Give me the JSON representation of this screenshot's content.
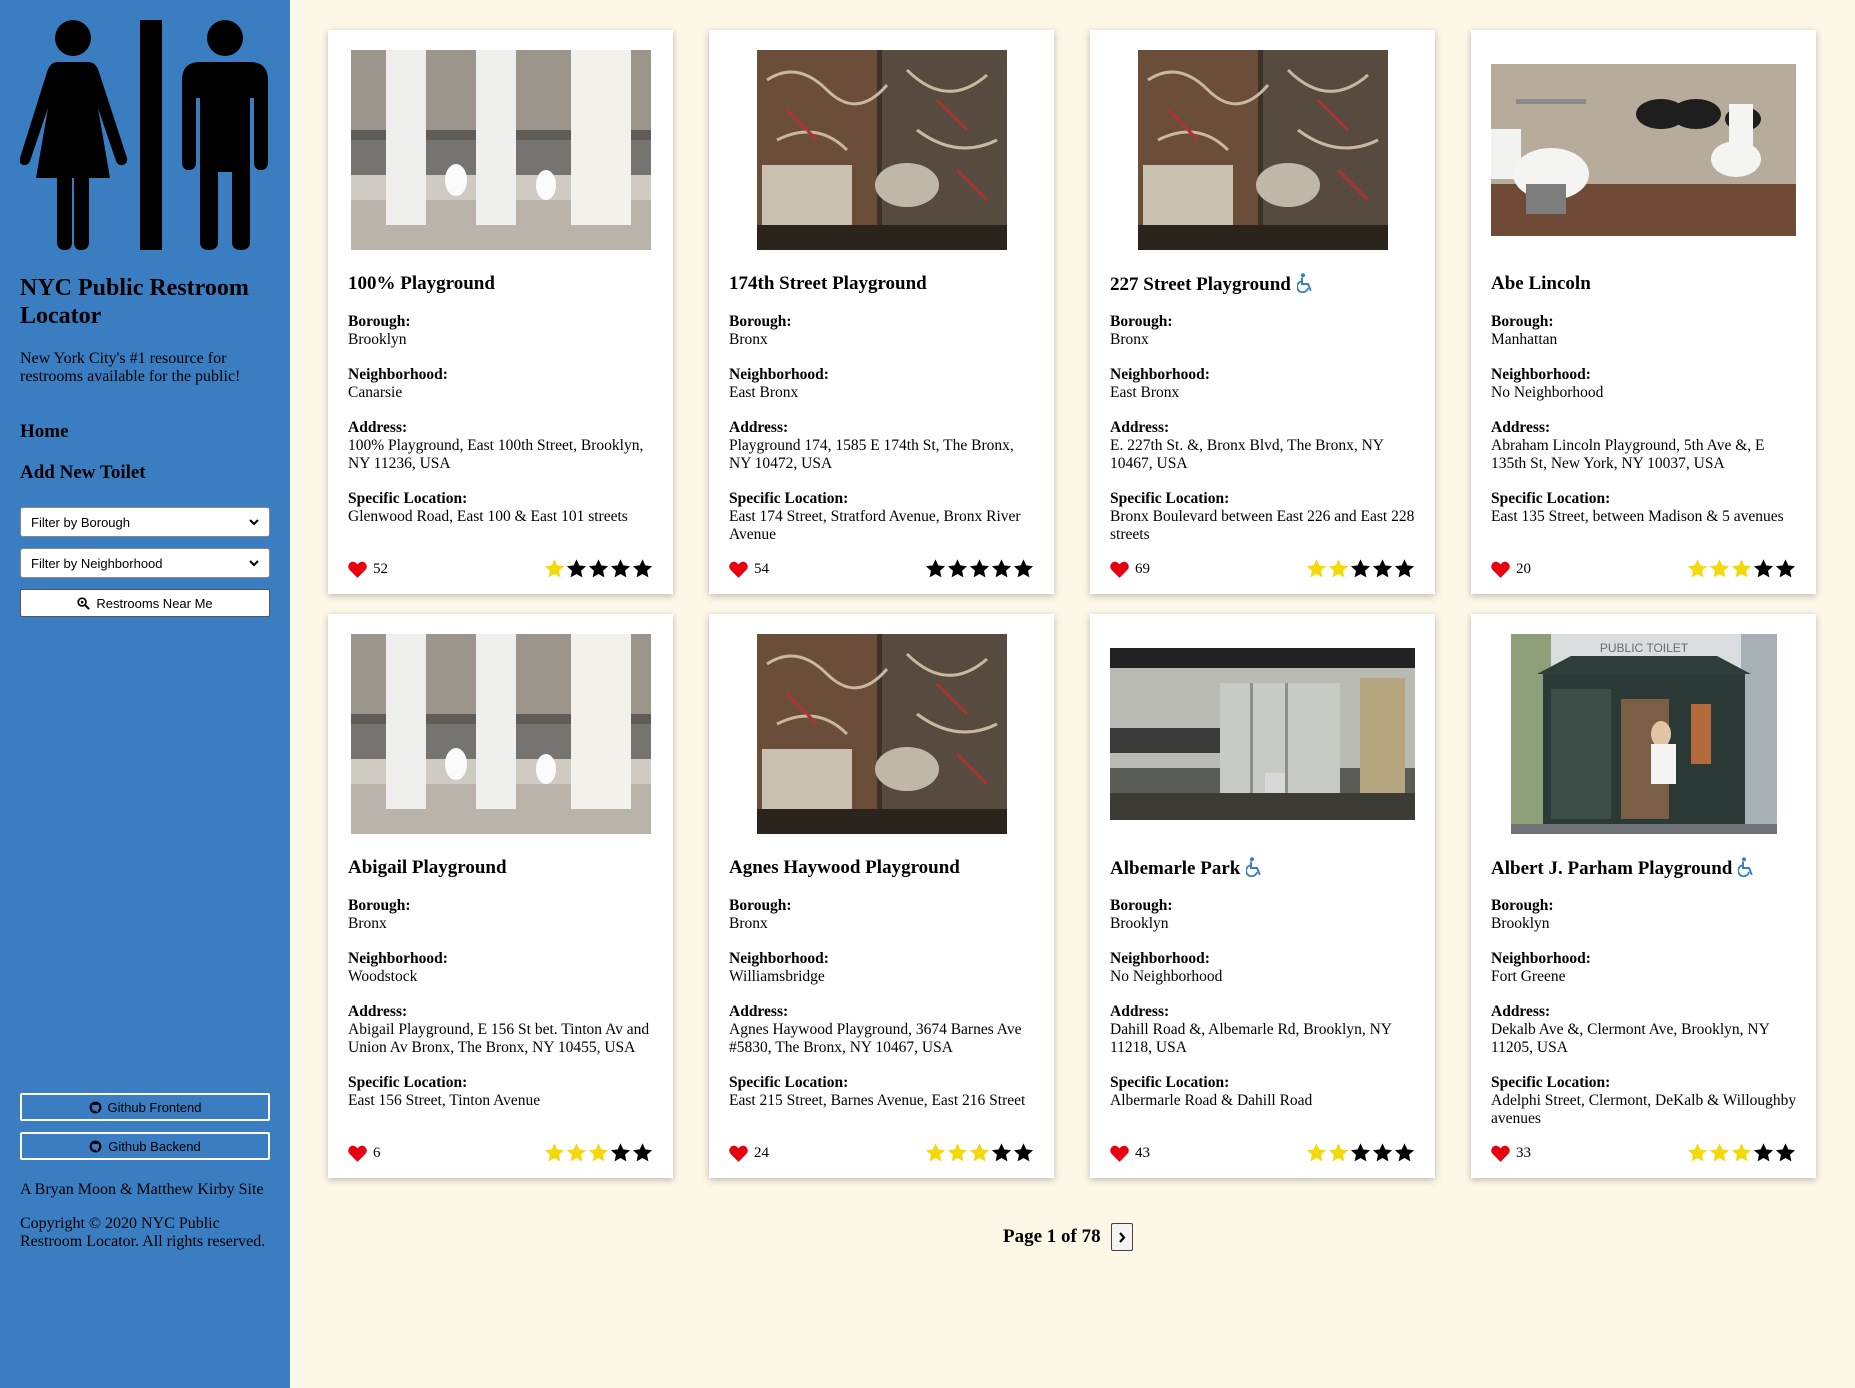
{
  "sidebar": {
    "title": "NYC Public Restroom Locator",
    "tagline": "New York City's #1 resource for restrooms available for the public!",
    "nav": [
      {
        "label": "Home"
      },
      {
        "label": "Add New Toilet"
      }
    ],
    "filter_borough": "Filter by Borough",
    "filter_neighborhood": "Filter by Neighborhood",
    "near_me": "Restrooms Near Me",
    "github_frontend": "Github Frontend",
    "github_backend": "Github Backend",
    "credits": "A Bryan Moon & Matthew Kirby Site",
    "copyright": "Copyright © 2020 NYC Public Restroom Locator. All rights reserved."
  },
  "labels": {
    "borough": "Borough:",
    "neighborhood": "Neighborhood:",
    "address": "Address:",
    "specific": "Specific Location:"
  },
  "colors": {
    "sidebar": "#3a7dc1",
    "background": "#fdf7e8",
    "heart": "#e8000e",
    "star_on": "#f4d90a",
    "accessible": "#3a7dc1"
  },
  "cards": [
    {
      "name": "100% Playground",
      "accessible": false,
      "borough": "Brooklyn",
      "neighborhood": "Canarsie",
      "address": "100% Playground, East 100th Street, Brooklyn, NY 11236, USA",
      "specific": "Glenwood Road, East 100 & East 101 streets",
      "likes": "52",
      "rating": 1,
      "photo": "stalls-icon"
    },
    {
      "name": "174th Street Playground",
      "accessible": false,
      "borough": "Bronx",
      "neighborhood": "East Bronx",
      "address": "Playground 174, 1585 E 174th St, The Bronx, NY 10472, USA",
      "specific": "East 174 Street, Stratford Avenue, Bronx River Avenue",
      "likes": "54",
      "rating": 0,
      "photo": "graffiti-icon"
    },
    {
      "name": "227 Street Playground",
      "accessible": true,
      "borough": "Bronx",
      "neighborhood": "East Bronx",
      "address": "E. 227th St. &, Bronx Blvd, The Bronx, NY 10467, USA",
      "specific": "Bronx Boulevard between East 226 and East 228 streets",
      "likes": "69",
      "rating": 2,
      "photo": "graffiti-icon"
    },
    {
      "name": "Abe Lincoln",
      "accessible": false,
      "borough": "Manhattan",
      "neighborhood": "No Neighborhood",
      "address": "Abraham Lincoln Playground, 5th Ave &, E 135th St, New York, NY 10037, USA",
      "specific": "East 135 Street, between Madison & 5 avenues",
      "likes": "20",
      "rating": 3,
      "photo": "toilets-icon"
    },
    {
      "name": "Abigail Playground",
      "accessible": false,
      "borough": "Bronx",
      "neighborhood": "Woodstock",
      "address": "Abigail Playground, E 156 St bet. Tinton Av and Union Av Bronx, The Bronx, NY 10455, USA",
      "specific": "East 156 Street, Tinton Avenue",
      "likes": "6",
      "rating": 3,
      "photo": "stalls-icon"
    },
    {
      "name": "Agnes Haywood Playground",
      "accessible": false,
      "borough": "Bronx",
      "neighborhood": "Williamsbridge",
      "address": "Agnes Haywood Playground, 3674 Barnes Ave #5830, The Bronx, NY 10467, USA",
      "specific": "East 215 Street, Barnes Avenue, East 216 Street",
      "likes": "24",
      "rating": 3,
      "photo": "graffiti-icon"
    },
    {
      "name": "Albemarle Park",
      "accessible": true,
      "borough": "Brooklyn",
      "neighborhood": "No Neighborhood",
      "address": "Dahill Road &, Albemarle Rd, Brooklyn, NY 11218, USA",
      "specific": "Albermarle Road & Dahill Road",
      "likes": "43",
      "rating": 2,
      "photo": "restroom-icon"
    },
    {
      "name": "Albert J. Parham Playground",
      "accessible": true,
      "borough": "Brooklyn",
      "neighborhood": "Fort Greene",
      "address": "Dekalb Ave &, Clermont Ave, Brooklyn, NY 11205, USA",
      "specific": "Adelphi Street, Clermont, DeKalb & Willoughby avenues",
      "likes": "33",
      "rating": 3,
      "photo": "kiosk-icon",
      "kiosk_sign": "PUBLIC TOILET"
    }
  ],
  "pagination": {
    "label": "Page 1 of 78"
  }
}
